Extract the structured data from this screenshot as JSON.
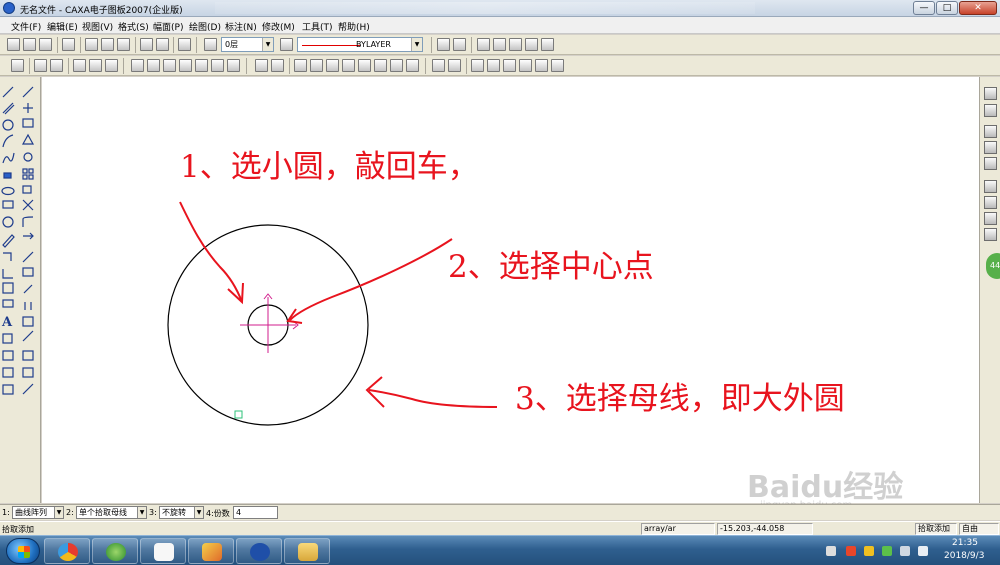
{
  "window": {
    "title": "无名文件 - CAXA电子图板2007(企业版)",
    "minimize_label": "—",
    "maximize_label": "□",
    "close_label": "✕"
  },
  "menu": [
    {
      "label": "文件(F)"
    },
    {
      "label": "编辑(E)"
    },
    {
      "label": "视图(V)"
    },
    {
      "label": "格式(S)"
    },
    {
      "label": "幅面(P)"
    },
    {
      "label": "绘图(D)"
    },
    {
      "label": "标注(N)"
    },
    {
      "label": "修改(M)"
    },
    {
      "label": "工具(T)"
    },
    {
      "label": "帮助(H)"
    }
  ],
  "toolbar": {
    "layer_value": "0层",
    "linetype_value": "BYLAYER",
    "line_color": "#e00000"
  },
  "annotations": {
    "step1": "1、选小圆，敲回车，",
    "step2": "2、选择中心点",
    "step3": "3、选择母线，即大外圆",
    "color": "#e8141e"
  },
  "command_bar": {
    "opt1_index": "1:",
    "opt1_value": "曲线阵列",
    "opt2_index": "2:",
    "opt2_value": "单个拾取母线",
    "opt3_index": "3:",
    "opt3_value": "不旋转",
    "opt4_label": "4:份数",
    "opt4_value": "4"
  },
  "status_bar": {
    "prompt": "拾取添加",
    "command": "array/ar",
    "coordinates": "-15.203,-44.058",
    "mode": "拾取添加",
    "snap": "自由"
  },
  "watermark": {
    "brand": "Baidu经验",
    "url": "jingyan.baidu.com"
  },
  "side_badge": "44",
  "taskbar": {
    "time": "21:35",
    "date": "2018/9/3"
  }
}
